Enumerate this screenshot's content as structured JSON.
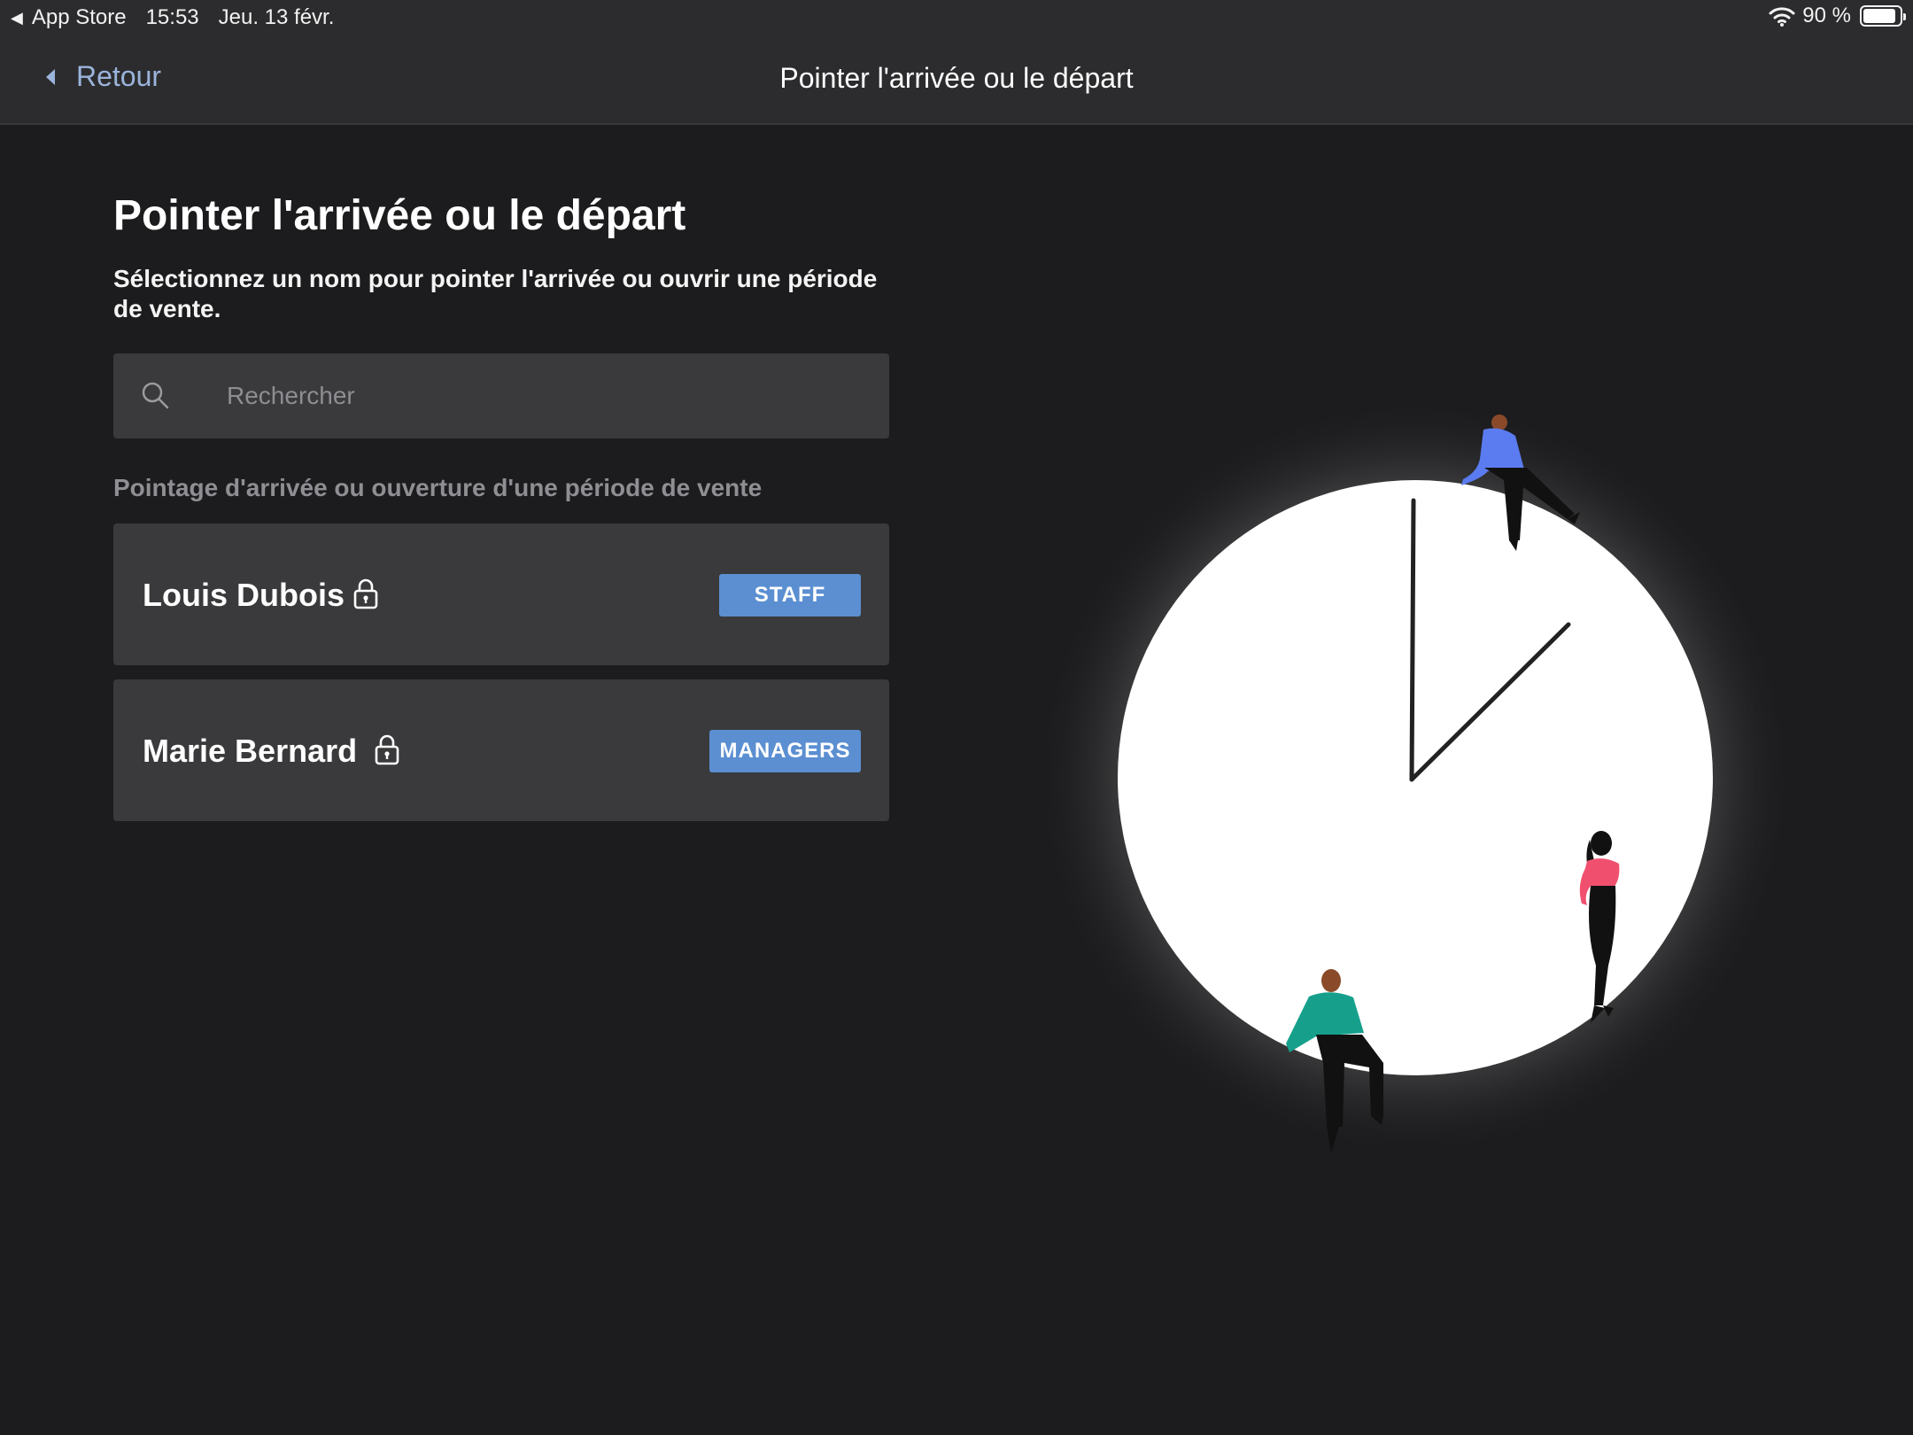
{
  "status_bar": {
    "back_app": "App Store",
    "time": "15:53",
    "date": "Jeu. 13 févr.",
    "battery_text": "90 %",
    "battery_level": 0.9,
    "icons": [
      "back-arrow-icon",
      "wifi-icon",
      "battery-icon"
    ]
  },
  "nav": {
    "back_label": "Retour",
    "title": "Pointer l'arrivée ou le départ"
  },
  "main": {
    "title": "Pointer l'arrivée ou le départ",
    "subtitle": "Sélectionnez un nom pour pointer l'arrivée ou ouvrir une période de vente.",
    "search": {
      "placeholder": "Rechercher",
      "value": "",
      "icon": "search-icon"
    },
    "section_label": "Pointage d'arrivée ou ouverture d'une période de vente",
    "employees": [
      {
        "name": "Louis Dubois",
        "role": "STAFF",
        "icon": "lock-icon"
      },
      {
        "name": "Marie Bernard",
        "role": "MANAGERS",
        "icon": "lock-icon"
      }
    ]
  },
  "colors": {
    "background": "#1c1c1e",
    "bar": "#2c2c2e",
    "card": "#3a3a3c",
    "accent_link": "#9bb4dc",
    "badge": "#5b8fd1",
    "figure_blue": "#5b7cf0",
    "figure_pink": "#f0506e",
    "figure_teal": "#16a08c"
  }
}
